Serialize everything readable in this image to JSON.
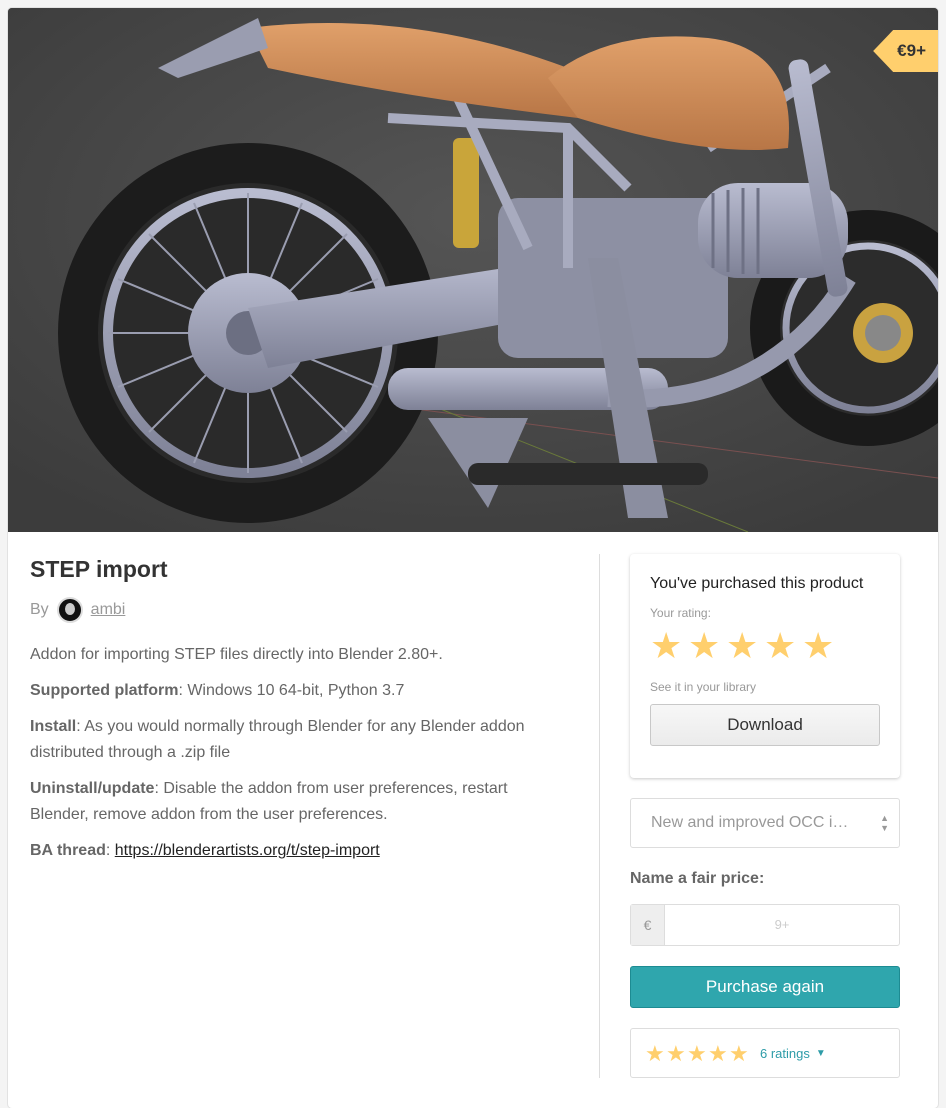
{
  "cover": {
    "price_tag": "€9+",
    "alt": "motorcycle-render"
  },
  "product": {
    "title": "STEP import",
    "by_label": "By",
    "author": "ambi",
    "description": [
      {
        "bold": "",
        "text": "Addon for importing STEP files directly into Blender 2.80+."
      },
      {
        "bold": "Supported platform",
        "text": ": Windows 10 64-bit, Python 3.7"
      },
      {
        "bold": "Install",
        "text": ": As you would normally through Blender for any Blender addon distributed through a .zip file"
      },
      {
        "bold": "Uninstall/update",
        "text": ": Disable the addon from user preferences, restart Blender, remove addon from the user preferences."
      }
    ],
    "thread_label": "BA thread",
    "thread_sep": ": ",
    "thread_link": "https://blenderartists.org/t/step-import"
  },
  "purchase_box": {
    "heading": "You've purchased this product",
    "your_rating_label": "Your rating:",
    "user_rating": 5,
    "library_text": "See it in your library",
    "download_label": "Download"
  },
  "version_select": {
    "value": "New and improved OCC import"
  },
  "pricing": {
    "fair_price_label": "Name a fair price:",
    "currency": "€",
    "placeholder": "9+",
    "purchase_label": "Purchase again"
  },
  "ratings_summary": {
    "average": 5,
    "count_text": "6 ratings"
  },
  "colors": {
    "accent": "#2fa6ad",
    "star": "#ffcf6d",
    "tag": "#ffcf6d"
  }
}
